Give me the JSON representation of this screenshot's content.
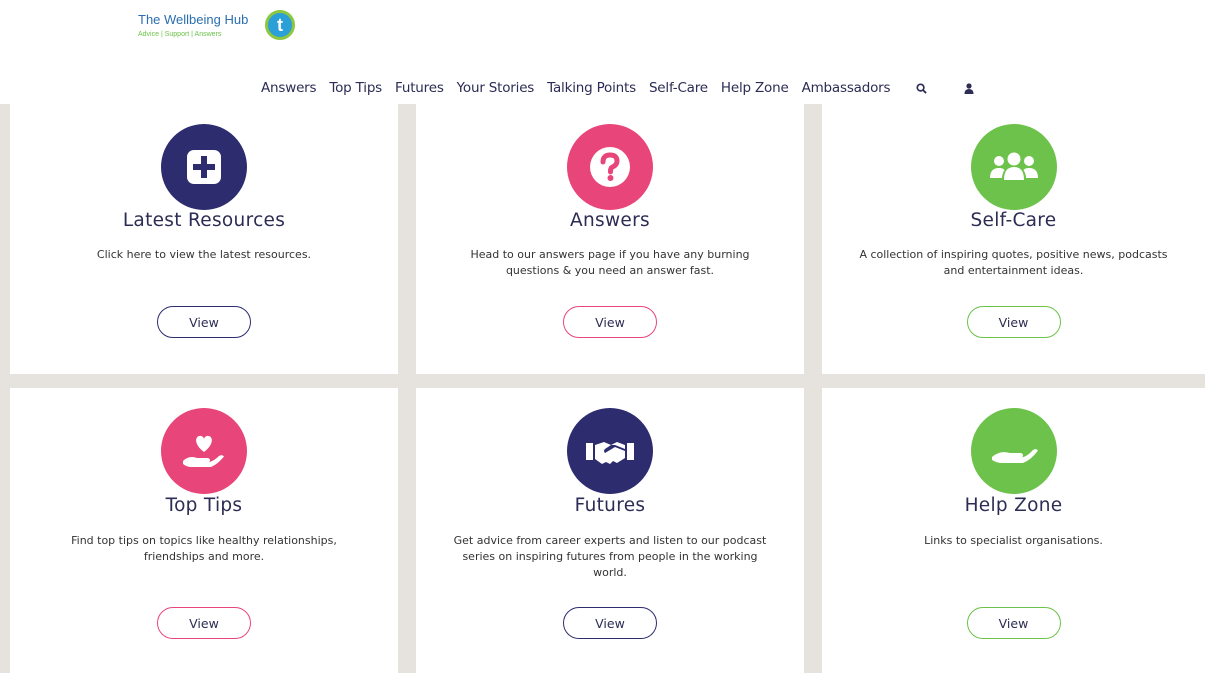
{
  "header": {
    "logo_title": "The Wellbeing Hub",
    "logo_tagline": "Advice | Support | Answers",
    "logo_badge": "t",
    "logo_badge_color": "#2a9fd8",
    "logo_ring_color": "#8dc63f"
  },
  "nav": {
    "items": [
      "Answers",
      "Top Tips",
      "Futures",
      "Your Stories",
      "Talking Points",
      "Self-Care",
      "Help Zone",
      "Ambassadors"
    ],
    "search_icon": "search-icon",
    "user_icon": "user-icon"
  },
  "colors": {
    "navy": "#2c2c6e",
    "pink": "#e8457a",
    "green": "#6cc24a",
    "grid_bg": "#e6e3df"
  },
  "cards": [
    {
      "title": "Latest Resources",
      "description": "Click here to view the latest resources.",
      "button": "View",
      "icon": "plus-square-icon",
      "color": "#2c2c6e"
    },
    {
      "title": "Answers",
      "description": "Head to our answers page if you have any burning questions & you need an answer fast.",
      "button": "View",
      "icon": "question-icon",
      "color": "#e8457a"
    },
    {
      "title": "Self-Care",
      "description": "A collection of inspiring quotes, positive news, podcasts and entertainment ideas.",
      "button": "View",
      "icon": "group-icon",
      "color": "#6cc24a"
    },
    {
      "title": "Top Tips",
      "description": "Find top tips on topics like healthy relationships, friendships and more.",
      "button": "View",
      "icon": "heart-hand-icon",
      "color": "#e8457a"
    },
    {
      "title": "Futures",
      "description": "Get advice from career experts and listen to our podcast series on inspiring futures from people in the working world.",
      "button": "View",
      "icon": "handshake-icon",
      "color": "#2c2c6e"
    },
    {
      "title": "Help Zone",
      "description": "Links to specialist organisations.",
      "button": "View",
      "icon": "open-hand-icon",
      "color": "#6cc24a"
    }
  ]
}
